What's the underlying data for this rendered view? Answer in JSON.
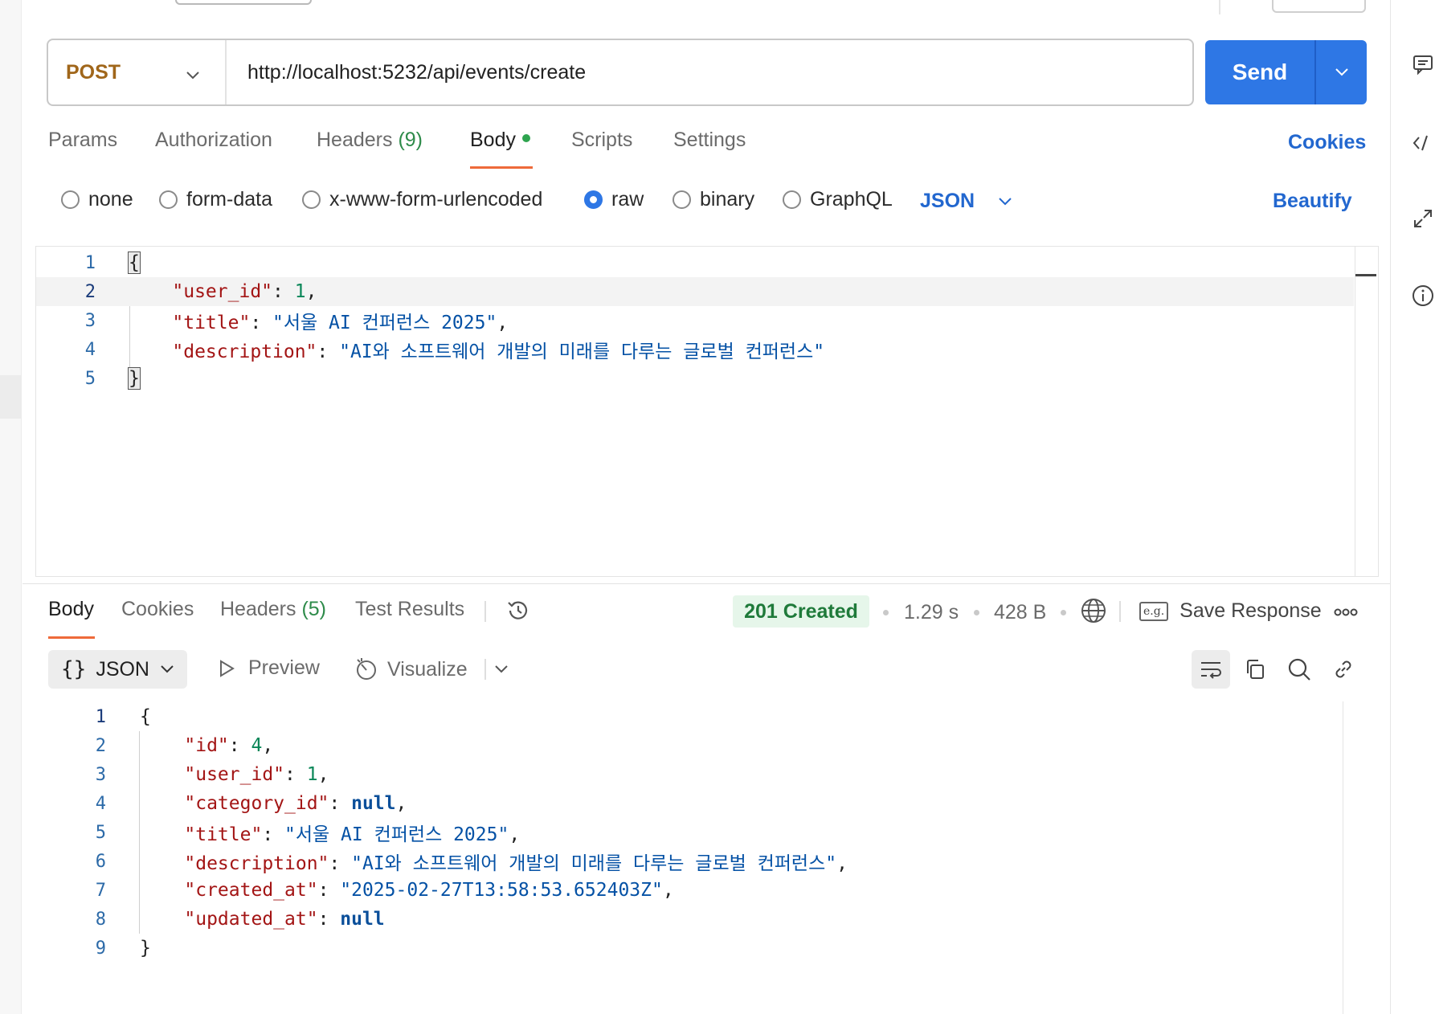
{
  "request": {
    "method": "POST",
    "url": "http://localhost:5232/api/events/create",
    "send_label": "Send",
    "tabs": [
      {
        "label": "Params"
      },
      {
        "label": "Authorization"
      },
      {
        "label": "Headers",
        "count": "(9)"
      },
      {
        "label": "Body"
      },
      {
        "label": "Scripts"
      },
      {
        "label": "Settings"
      }
    ],
    "cookies_label": "Cookies",
    "body_types": [
      "none",
      "form-data",
      "x-www-form-urlencoded",
      "raw",
      "binary",
      "GraphQL"
    ],
    "selected_body_type": "raw",
    "format_label": "JSON",
    "beautify_label": "Beautify",
    "line_numbers": [
      "1",
      "2",
      "3",
      "4",
      "5"
    ],
    "body": {
      "user_id_key": "\"user_id\"",
      "user_id_value": "1",
      "title_key": "\"title\"",
      "title_value": "\"서울 AI 컨퍼런스 2025\"",
      "description_key": "\"description\"",
      "description_value": "\"AI와 소프트웨어 개발의 미래를 다루는 글로벌 컨퍼런스\""
    }
  },
  "response": {
    "tabs": [
      {
        "label": "Body"
      },
      {
        "label": "Cookies"
      },
      {
        "label": "Headers",
        "count": "(5)"
      },
      {
        "label": "Test Results"
      }
    ],
    "status": "201 Created",
    "time": "1.29 s",
    "size": "428 B",
    "save_response_label": "Save Response",
    "eg_label": "e.g.",
    "format_label": "JSON",
    "preview_label": "Preview",
    "visualize_label": "Visualize",
    "line_numbers": [
      "1",
      "2",
      "3",
      "4",
      "5",
      "6",
      "7",
      "8",
      "9"
    ],
    "body": {
      "id_key": "\"id\"",
      "id_value": "4",
      "user_id_key": "\"user_id\"",
      "user_id_value": "1",
      "category_id_key": "\"category_id\"",
      "category_id_value": "null",
      "title_key": "\"title\"",
      "title_value": "\"서울 AI 컨퍼런스 2025\"",
      "description_key": "\"description\"",
      "description_value": "\"AI와 소프트웨어 개발의 미래를 다루는 글로벌 컨퍼런스\"",
      "created_at_key": "\"created_at\"",
      "created_at_value": "\"2025-02-27T13:58:53.652403Z\"",
      "updated_at_key": "\"updated_at\"",
      "updated_at_value": "null"
    }
  },
  "colors": {
    "accent": "#2e77e5",
    "tab_underline": "#ee6a3a",
    "method": "#a0661a",
    "status_ok_bg": "#e6f6ea",
    "status_ok_text": "#1f7a3a"
  },
  "icons": [
    "chevron-down-icon",
    "comment-icon",
    "code-icon",
    "expand-icon",
    "info-icon",
    "history-icon",
    "globe-icon",
    "more-icon",
    "play-icon",
    "visualize-icon",
    "wrap-icon",
    "copy-icon",
    "search-icon",
    "link-icon"
  ]
}
